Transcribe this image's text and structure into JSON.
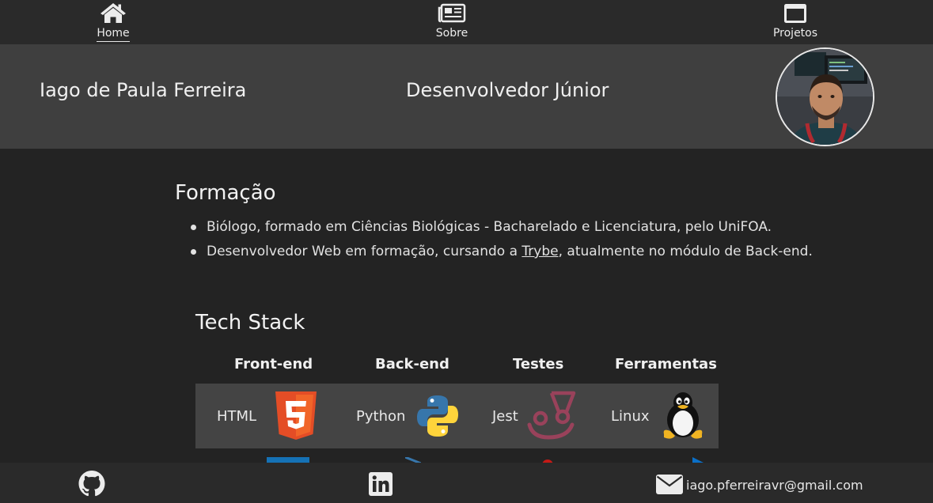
{
  "nav": {
    "items": [
      {
        "label": "Home",
        "icon": "home-icon",
        "active": true
      },
      {
        "label": "Sobre",
        "icon": "newspaper-icon",
        "active": false
      },
      {
        "label": "Projetos",
        "icon": "window-icon",
        "active": false
      }
    ]
  },
  "header": {
    "name": "Iago de Paula Ferreira",
    "role": "Desenvolvedor Júnior"
  },
  "formacao": {
    "title": "Formação",
    "item1": "Biólogo, formado em Ciências Biológicas - Bacharelado e Licenciatura, pelo UniFOA.",
    "item2_before": "Desenvolvedor Web em formação, cursando a ",
    "item2_link": "Trybe",
    "item2_after": ", atualmente no módulo de Back-end."
  },
  "tech_stack": {
    "title": "Tech Stack",
    "columns": [
      "Front-end",
      "Back-end",
      "Testes",
      "Ferramentas"
    ],
    "row1": [
      {
        "name": "HTML",
        "icon": "html5-icon"
      },
      {
        "name": "Python",
        "icon": "python-icon"
      },
      {
        "name": "Jest",
        "icon": "jest-icon"
      },
      {
        "name": "Linux",
        "icon": "tux-icon"
      }
    ]
  },
  "footer": {
    "email": "iago.pferreiravr@gmail.com"
  },
  "colors": {
    "background": "#232323",
    "nav_bar": "#2a2a2a",
    "header_band": "#3f3f3f",
    "stack_row": "#444444",
    "html5_orange": "#e44d26",
    "jest_red": "#99425b",
    "python_blue": "#3776ab",
    "python_yellow": "#ffd43b"
  }
}
